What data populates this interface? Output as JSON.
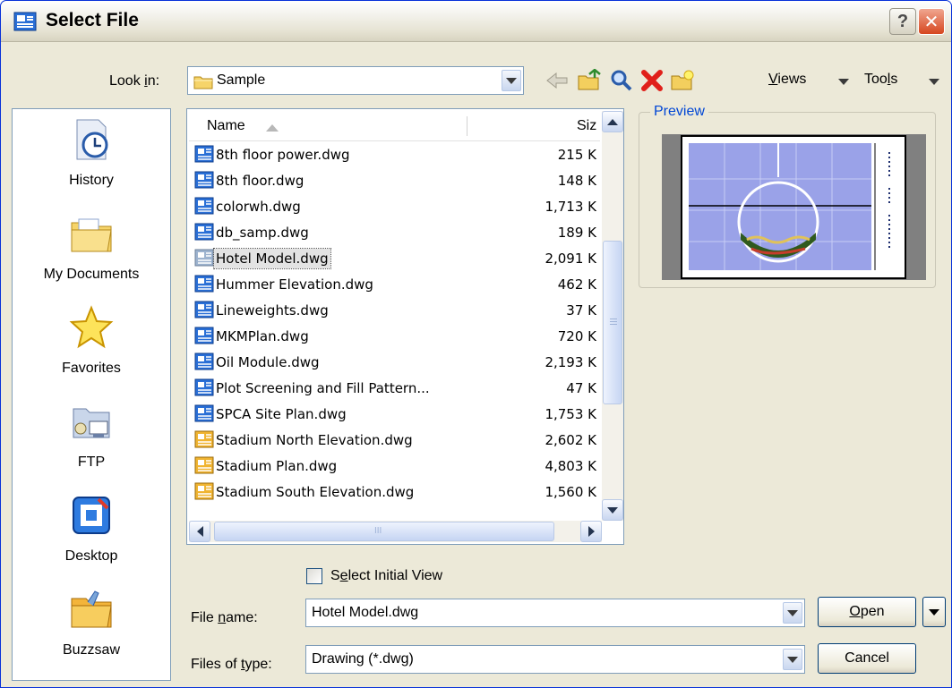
{
  "window": {
    "title": "Select File",
    "help_label": "?",
    "close_label": "✕"
  },
  "lookin": {
    "label_pre": "Look ",
    "label_key": "i",
    "label_post": "n:",
    "value": "Sample"
  },
  "toolbar": {
    "icons": [
      "back-icon",
      "up-folder-icon",
      "search-web-icon",
      "delete-icon",
      "new-folder-icon"
    ],
    "views_key": "V",
    "views_rest": "iews",
    "tools_pre": "Too",
    "tools_key": "l",
    "tools_post": "s"
  },
  "places": [
    {
      "label": "History",
      "icon": "history-icon"
    },
    {
      "label": "My Documents",
      "icon": "my-documents-icon"
    },
    {
      "label": "Favorites",
      "icon": "favorites-icon"
    },
    {
      "label": "FTP",
      "icon": "ftp-icon"
    },
    {
      "label": "Desktop",
      "icon": "desktop-icon"
    },
    {
      "label": "Buzzsaw",
      "icon": "buzzsaw-icon"
    }
  ],
  "filelist": {
    "col_name": "Name",
    "col_size": "Siz",
    "h_scroll_grip": "III",
    "files": [
      {
        "name": "8th floor power.dwg",
        "size": "215 K",
        "icon": "dwg-blue"
      },
      {
        "name": "8th floor.dwg",
        "size": "148 K",
        "icon": "dwg-blue"
      },
      {
        "name": "colorwh.dwg",
        "size": "1,713 K",
        "icon": "dwg-blue"
      },
      {
        "name": "db_samp.dwg",
        "size": "189 K",
        "icon": "dwg-blue"
      },
      {
        "name": "Hotel Model.dwg",
        "size": "2,091 K",
        "icon": "dwg-gray",
        "selected": true
      },
      {
        "name": "Hummer Elevation.dwg",
        "size": "462 K",
        "icon": "dwg-blue"
      },
      {
        "name": "Lineweights.dwg",
        "size": "37 K",
        "icon": "dwg-blue"
      },
      {
        "name": "MKMPlan.dwg",
        "size": "720 K",
        "icon": "dwg-blue"
      },
      {
        "name": "Oil Module.dwg",
        "size": "2,193 K",
        "icon": "dwg-blue"
      },
      {
        "name": "Plot Screening and Fill Pattern...",
        "size": "47 K",
        "icon": "dwg-blue"
      },
      {
        "name": "SPCA Site Plan.dwg",
        "size": "1,753 K",
        "icon": "dwg-blue"
      },
      {
        "name": "Stadium North Elevation.dwg",
        "size": "2,602 K",
        "icon": "dwg-yellow"
      },
      {
        "name": "Stadium Plan.dwg",
        "size": "4,803 K",
        "icon": "dwg-yellow"
      },
      {
        "name": "Stadium South Elevation.dwg",
        "size": "1,560 K",
        "icon": "dwg-yellow"
      }
    ]
  },
  "preview": {
    "label": "Preview"
  },
  "initial_view": {
    "pre": "S",
    "key": "e",
    "post": "lect Initial View",
    "checked": false
  },
  "filename": {
    "label_pre": "File ",
    "label_key": "n",
    "label_post": "ame:",
    "value": "Hotel Model.dwg"
  },
  "filetype": {
    "label_pre": "Files of ",
    "label_key": "t",
    "label_post": "ype:",
    "value": "Drawing (*.dwg)"
  },
  "buttons": {
    "open_key": "O",
    "open_rest": "pen",
    "cancel": "Cancel"
  },
  "colors": {
    "accent": "#0831d9",
    "preview_label": "#0046d5",
    "dialog_bg": "#ece9d8"
  }
}
